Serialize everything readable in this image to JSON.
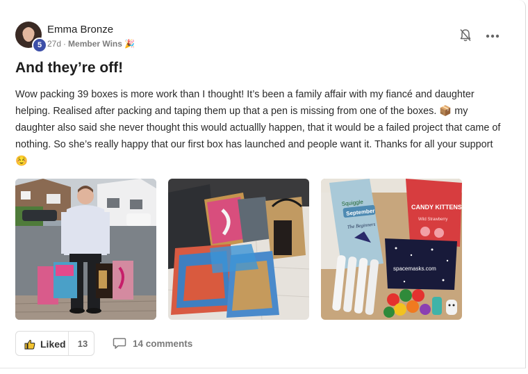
{
  "post": {
    "author": {
      "name": "Emma Bronze",
      "level": "5"
    },
    "age": "27d",
    "separator": "·",
    "category": "Member Wins",
    "category_emoji": "🎉",
    "title": "And they’re off!",
    "body": "Wow packing 39 boxes is more work than I thought! It’s been a family affair with my fiancé and daughter helping. Realised after packing and taping them up that a pen is missing from one of the boxes. 📦 my daughter also said she never thought this would actuallly happen, that it would be a failed project that came of nothing. So she’s really happy that our first box has launched and people want it. Thanks for all your support ☺️",
    "images": [
      {
        "name": "man-holding-bags-photo",
        "labels": []
      },
      {
        "name": "packed-bags-photo",
        "labels": []
      },
      {
        "name": "box-contents-photo",
        "labels": [
          "September",
          "CANDY KITTENS",
          "Wild Strawberry",
          "spacemasks.com",
          "The Beginners"
        ]
      }
    ]
  },
  "actions": {
    "like_label": "Liked",
    "like_count": "13",
    "comments_label": "14 comments"
  },
  "icons": {
    "bell": "bell-off-icon",
    "more": "more-horizontal-icon",
    "like": "thumbs-up-icon",
    "comment": "comment-bubble-icon"
  },
  "colors": {
    "level_badge": "#3d4fa8",
    "text": "#202124",
    "muted": "#7c7c7c"
  }
}
